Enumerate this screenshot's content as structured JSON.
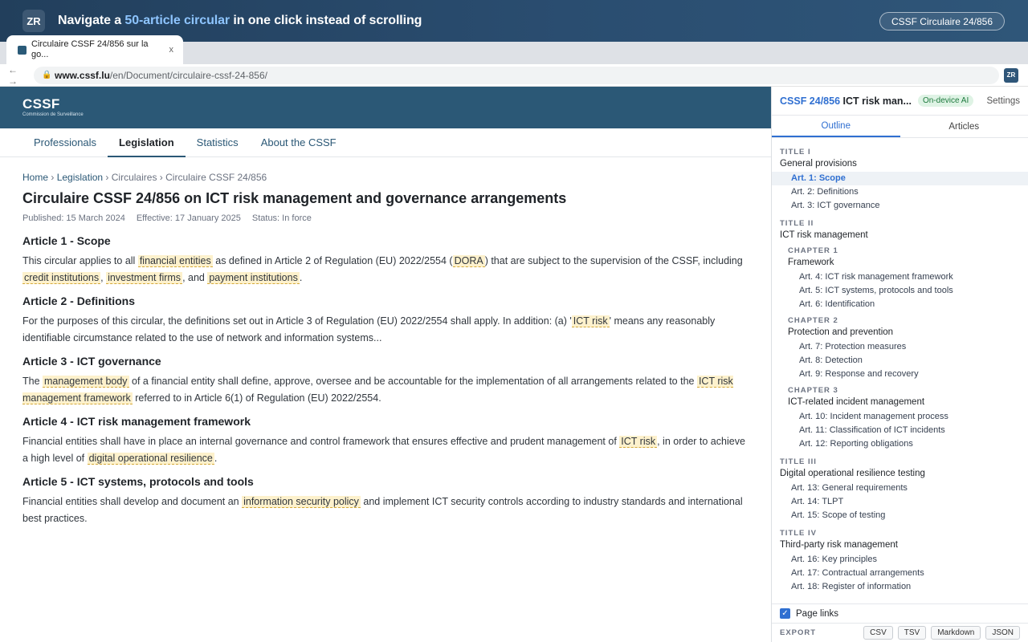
{
  "banner": {
    "logo": "ZR",
    "headline_pre": "Navigate a ",
    "headline_highlight": "50-article circular",
    "headline_post": " in one click instead of scrolling",
    "pill": "CSSF Circulaire 24/856"
  },
  "browser": {
    "tab_title": "Circulaire CSSF 24/856 sur la go...",
    "tab_close": "x",
    "nav_arrows": "← →",
    "lock_icon": "🔒",
    "url_host": "www.cssf.lu",
    "url_path": "/en/Document/circulaire-cssf-24-856/",
    "extension_icon": "ZR"
  },
  "site": {
    "logo": "CSSF",
    "logo_sub": "Commission de Surveillance",
    "nav": [
      "Professionals",
      "Legislation",
      "Statistics",
      "About the CSSF"
    ],
    "nav_active": "Legislation",
    "breadcrumb": [
      "Home",
      "Legislation",
      "Circulaires",
      "Circulaire CSSF 24/856"
    ],
    "breadcrumb_sep": "›",
    "title": "Circulaire CSSF 24/856 on ICT risk management and governance arrangements",
    "published": "Published: 15 March 2024",
    "effective": "Effective: 17 January 2025",
    "status": "Status: In force"
  },
  "articles": {
    "a1": {
      "heading": "Article 1 - Scope",
      "t1": "This circular applies to all ",
      "k1": "financial entities",
      "t2": " as defined in Article 2 of Regulation (EU) 2022/2554 (",
      "k2": "DORA",
      "t3": ") that are subject to the supervision of the CSSF, including ",
      "k3": "credit institutions",
      "t4": ", ",
      "k4": "investment firms",
      "t5": ", and ",
      "k5": "payment institutions",
      "t6": "."
    },
    "a2": {
      "heading": "Article 2 - Definitions",
      "t1": "For the purposes of this circular, the definitions set out in Article 3 of Regulation (EU) 2022/2554 shall apply. In addition: (a) '",
      "k1": "ICT risk",
      "t2": "' means any reasonably identifiable circumstance related to the use of network and information systems..."
    },
    "a3": {
      "heading": "Article 3 - ICT governance",
      "t1": "The ",
      "k1": "management body",
      "t2": " of a financial entity shall define, approve, oversee and be accountable for the implementation of all arrangements related to the ",
      "k2": "ICT risk management framework",
      "t3": " referred to in Article 6(1) of Regulation (EU) 2022/2554."
    },
    "a4": {
      "heading": "Article 4 - ICT risk management framework",
      "t1": "Financial entities shall have in place an internal governance and control framework that ensures effective and prudent management of ",
      "k1": "ICT risk",
      "t2": ", in order to achieve a high level of ",
      "k2": "digital operational resilience",
      "t3": "."
    },
    "a5": {
      "heading": "Article 5 - ICT systems, protocols and tools",
      "t1": "Financial entities shall develop and document an ",
      "k1": "information security policy",
      "t2": " and implement ICT security controls according to industry standards and international best practices."
    }
  },
  "panel": {
    "title_ref": "CSSF 24/856",
    "title_rest": " ICT risk man...",
    "ai_badge": "On-device AI",
    "settings": "Settings",
    "tabs": [
      "Outline",
      "Articles"
    ],
    "active_tab": "Outline",
    "outline": {
      "t1": {
        "label": "TITLE I",
        "name": "General provisions",
        "arts": [
          "Art. 1: Scope",
          "Art. 2: Definitions",
          "Art. 3: ICT governance"
        ]
      },
      "t2": {
        "label": "TITLE II",
        "name": "ICT risk management",
        "c1": {
          "label": "CHAPTER 1",
          "name": "Framework",
          "arts": [
            "Art. 4: ICT risk management framework",
            "Art. 5: ICT systems, protocols and tools",
            "Art. 6: Identification"
          ]
        },
        "c2": {
          "label": "CHAPTER 2",
          "name": "Protection and prevention",
          "arts": [
            "Art. 7: Protection measures",
            "Art. 8: Detection",
            "Art. 9: Response and recovery"
          ]
        },
        "c3": {
          "label": "CHAPTER 3",
          "name": "ICT-related incident management",
          "arts": [
            "Art. 10: Incident management process",
            "Art. 11: Classification of ICT incidents",
            "Art. 12: Reporting obligations"
          ]
        }
      },
      "t3": {
        "label": "TITLE III",
        "name": "Digital operational resilience testing",
        "arts": [
          "Art. 13: General requirements",
          "Art. 14: TLPT",
          "Art. 15: Scope of testing"
        ]
      },
      "t4": {
        "label": "TITLE IV",
        "name": "Third-party risk management",
        "arts": [
          "Art. 16: Key principles",
          "Art. 17: Contractual arrangements",
          "Art. 18: Register of information"
        ]
      }
    },
    "page_links": "Page links",
    "page_links_checked": true,
    "export_label": "EXPORT",
    "export_buttons": [
      "CSV",
      "TSV",
      "Markdown",
      "JSON"
    ]
  }
}
